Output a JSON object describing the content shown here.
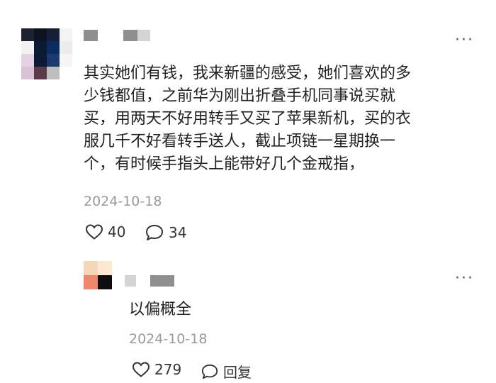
{
  "comment": {
    "text": "其实她们有钱，我来新疆的感受，她们喜欢的多\n少钱都值，之前华为刚出折叠手机同事说买就\n买，用两天不好用转手又买了苹果新机，买的衣\n服几千不好看转手送人，截止项链一星期换一\n个，有时候手指头上能带好几个金戒指，",
    "date": "2024-10-18",
    "like_count": "40",
    "reply_count": "34",
    "more_label": "···",
    "icons": {
      "like": "heart-icon",
      "reply": "speech-bubble-icon"
    },
    "avatar_colors": [
      "#1e2230",
      "#0c1422",
      "#141f38",
      "#f3f3f3",
      "#f2f2f2",
      "#0a1a33",
      "#0d2c5e",
      "#ececec",
      "#e4d2e4",
      "#0d1a35",
      "#1a3a70",
      "#f5f5f5",
      "#d8c2d4",
      "#5b3a48",
      "#bdbdbd",
      "#ffffff"
    ]
  },
  "reply": {
    "text": "以偏概全",
    "date": "2024-10-18",
    "like_count": "279",
    "reply_label": "回复",
    "more_label": "···",
    "avatar_colors": [
      "#f6d6b8",
      "#fbe7d2",
      "#f0866a",
      "#0e0e0e"
    ]
  }
}
